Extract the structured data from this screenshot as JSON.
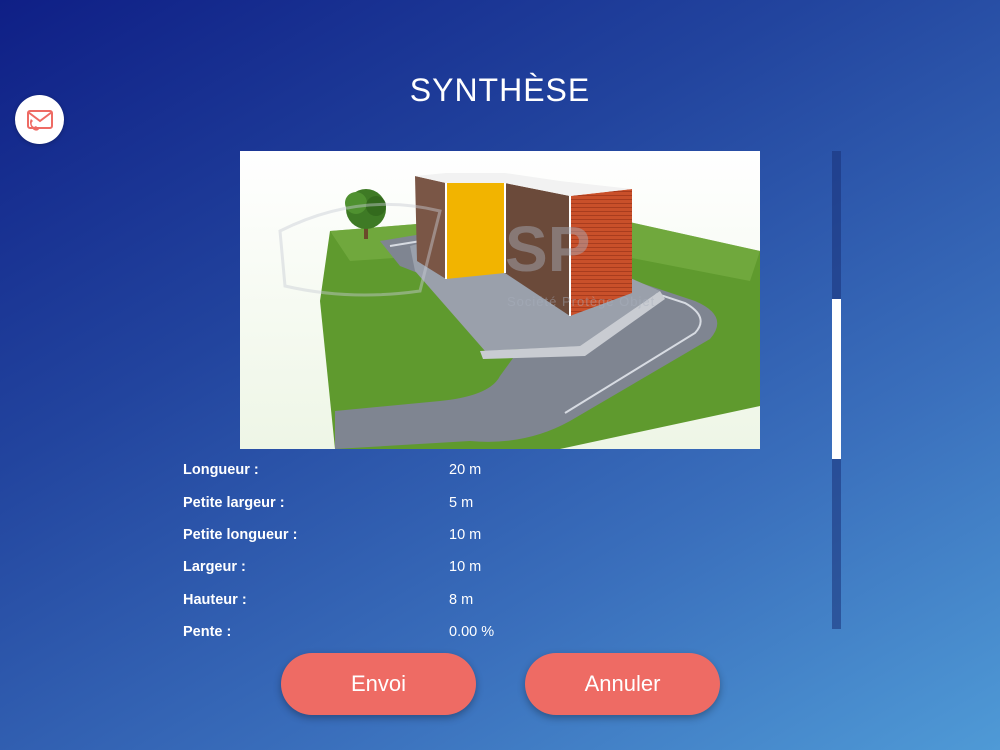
{
  "header": {
    "title": "SYNTHÈSE"
  },
  "contact": {
    "icon": "envelope-phone-icon",
    "accent": "#ee6b64"
  },
  "preview": {
    "watermark": {
      "brand": "SP",
      "tagline": "Société Protège Objet"
    }
  },
  "specs": [
    {
      "label": "Longueur :",
      "value": "20 m"
    },
    {
      "label": "Petite largeur :",
      "value": "5 m"
    },
    {
      "label": "Petite longueur :",
      "value": "10 m"
    },
    {
      "label": "Largeur :",
      "value": "10 m"
    },
    {
      "label": "Hauteur :",
      "value": "8 m"
    },
    {
      "label": "Pente :",
      "value": "0.00 %"
    }
  ],
  "scroll": {
    "position_fraction": 0.31,
    "visible_fraction": 0.335
  },
  "actions": {
    "send_label": "Envoi",
    "cancel_label": "Annuler"
  },
  "colors": {
    "button": "#ee6b64",
    "yellow_panel": "#f2b400",
    "orange_panel": "#c9502a",
    "brown_panel": "#6b4a3a",
    "grass": "#5f9a2e"
  }
}
